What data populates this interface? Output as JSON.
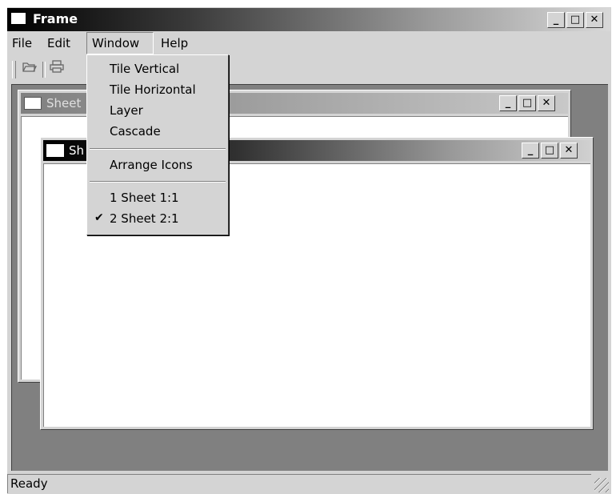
{
  "window": {
    "title": "Frame",
    "buttons": {
      "minimize": "_",
      "maximize": "□",
      "close": "✕"
    }
  },
  "menubar": {
    "items": [
      {
        "label": "File"
      },
      {
        "label": "Edit"
      },
      {
        "label": "Window"
      },
      {
        "label": "Help"
      }
    ]
  },
  "toolbar": {
    "icons": [
      "open-folder-icon",
      "print-icon"
    ]
  },
  "children": [
    {
      "title": "Sheet",
      "buttons": {
        "minimize": "_",
        "maximize": "□",
        "close": "✕"
      }
    },
    {
      "title": "Sh",
      "buttons": {
        "minimize": "_",
        "maximize": "□",
        "close": "✕"
      }
    }
  ],
  "window_menu": {
    "group1": [
      "Tile Vertical",
      "Tile Horizontal",
      "Layer",
      "Cascade"
    ],
    "group2": [
      "Arrange Icons"
    ],
    "group3": [
      "1 Sheet 1:1",
      "2 Sheet 2:1"
    ],
    "checkmark": "✔"
  },
  "status": {
    "text": "Ready"
  }
}
